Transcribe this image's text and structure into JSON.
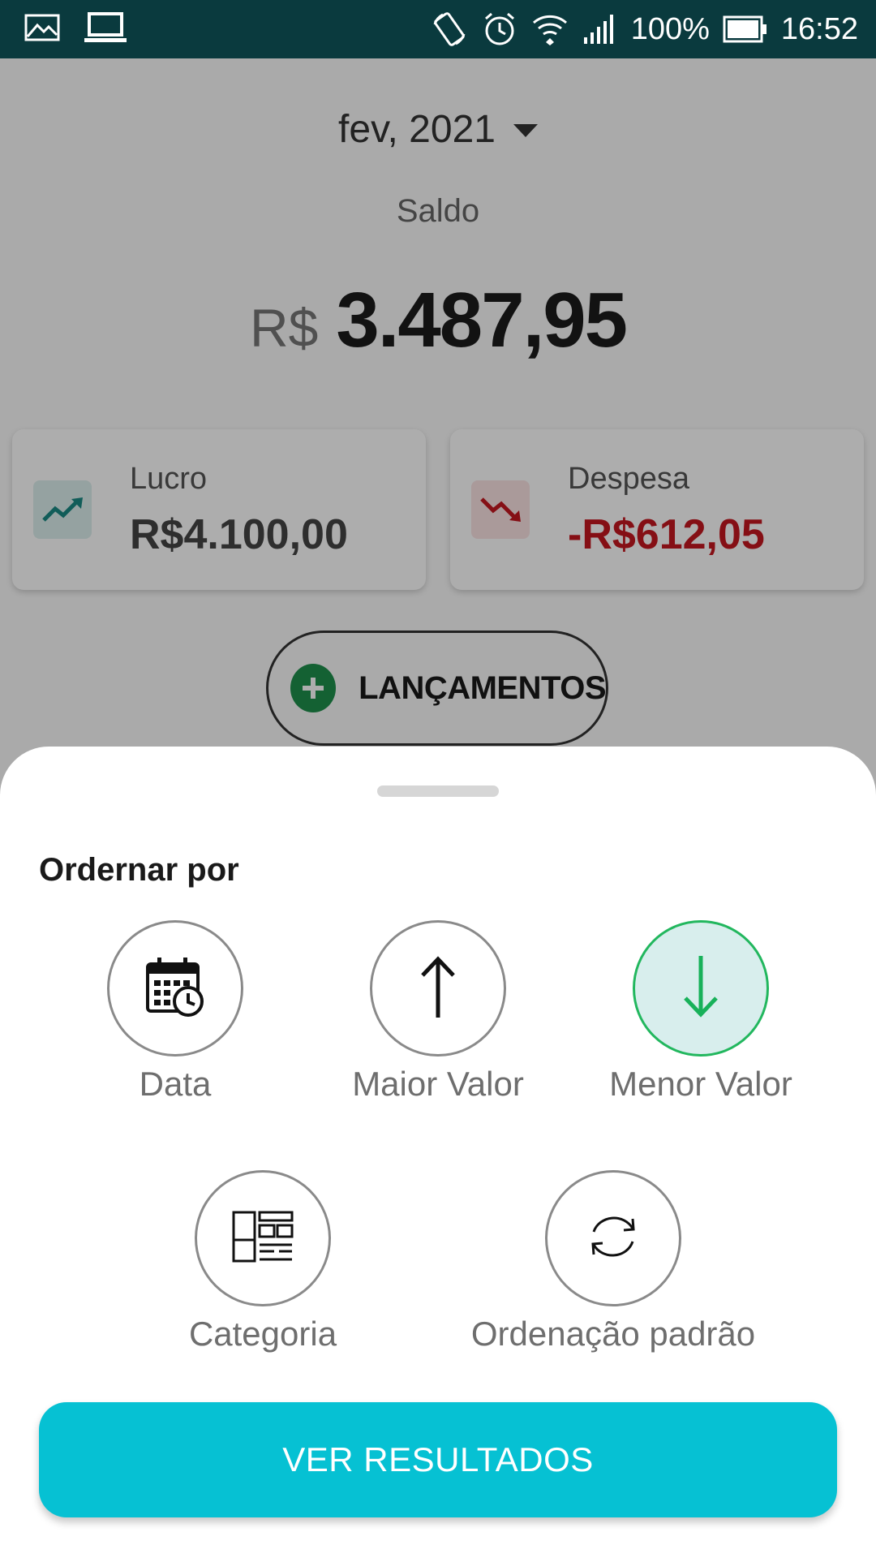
{
  "status_bar": {
    "battery": "100%",
    "time": "16:52",
    "icons": [
      "image-icon",
      "laptop-icon",
      "rotate-icon",
      "alarm-icon",
      "wifi-icon",
      "signal-icon",
      "battery-icon"
    ]
  },
  "header": {
    "month": "fev, 2021",
    "balance_label": "Saldo",
    "currency": "R$",
    "balance": "3.487,95"
  },
  "cards": {
    "profit": {
      "label": "Lucro",
      "value": "R$4.100,00",
      "icon": "trending-up-icon"
    },
    "expense": {
      "label": "Despesa",
      "value": "-R$612,05",
      "icon": "trending-down-icon"
    }
  },
  "lancamentos_button": {
    "label": "LANÇAMENTOS",
    "icon": "plus-icon"
  },
  "sort_sheet": {
    "title": "Ordernar por",
    "options": [
      {
        "label": "Data",
        "icon": "calendar-clock-icon",
        "selected": false
      },
      {
        "label": "Maior Valor",
        "icon": "arrow-up-icon",
        "selected": false
      },
      {
        "label": "Menor Valor",
        "icon": "arrow-down-icon",
        "selected": true
      },
      {
        "label": "Categoria",
        "icon": "layout-icon",
        "selected": false
      },
      {
        "label": "Ordenação padrão",
        "icon": "refresh-icon",
        "selected": false
      }
    ],
    "submit_label": "VER RESULTADOS"
  },
  "colors": {
    "status_bar": "#0a3a3e",
    "accent": "#06c1d3",
    "selected_border": "#22b75e",
    "selected_fill": "#d8eeed",
    "negative": "#c4171f",
    "positive_icon": "#1a8a84"
  }
}
